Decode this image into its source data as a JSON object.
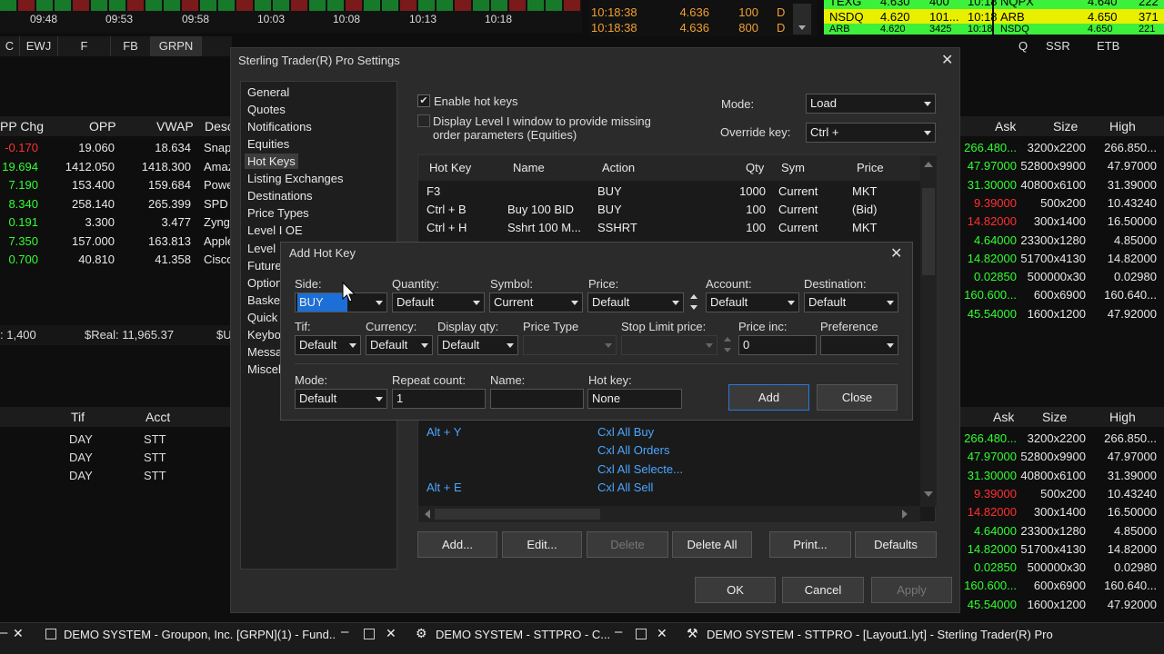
{
  "chart": {
    "times": [
      "09:48",
      "09:53",
      "09:58",
      "10:03",
      "10:08",
      "10:13",
      "10:18"
    ]
  },
  "time_sales": [
    {
      "time": "10:18:38",
      "price": "4.636",
      "size": "100",
      "ex": "D"
    },
    {
      "time": "10:18:38",
      "price": "4.636",
      "size": "800",
      "ex": "D"
    }
  ],
  "level2": {
    "row1": [
      "TEXG",
      "4.630",
      "400",
      "10:18",
      "NQPX",
      "4.640",
      "222"
    ],
    "row2": [
      "NSDQ",
      "4.620",
      "101...",
      "10:18",
      "ARB",
      "4.650",
      "371"
    ],
    "row3": [
      "ARB",
      "4.620",
      "3425",
      "10:18",
      "NSDQ",
      "4.650",
      "221"
    ]
  },
  "tabs": [
    "C",
    "EWJ",
    "F",
    "FB",
    "GRPN"
  ],
  "ticker_headers": {
    "pp_chg": "PP Chg",
    "opp": "OPP",
    "vwap": "VWAP",
    "desc": "Desc"
  },
  "ticker_rows": [
    {
      "chg": "-0.170",
      "opp": "19.060",
      "vwap": "18.634",
      "desc": "Snap",
      "cls": "red"
    },
    {
      "chg": "19.694",
      "opp": "1412.050",
      "vwap": "1418.300",
      "desc": "Amaz",
      "cls": "grn"
    },
    {
      "chg": "7.190",
      "opp": "153.400",
      "vwap": "159.684",
      "desc": "Powe",
      "cls": "grn"
    },
    {
      "chg": "8.340",
      "opp": "258.140",
      "vwap": "265.399",
      "desc": "SPD",
      "cls": "grn"
    },
    {
      "chg": "0.191",
      "opp": "3.300",
      "vwap": "3.477",
      "desc": "Zyng",
      "cls": "grn"
    },
    {
      "chg": "7.350",
      "opp": "157.000",
      "vwap": "163.813",
      "desc": "Apple",
      "cls": "grn"
    },
    {
      "chg": "0.700",
      "opp": "40.810",
      "vwap": "41.358",
      "desc": "Cisco",
      "cls": "grn"
    }
  ],
  "account_bar": {
    "left": ": 1,400",
    "sreal": "$Real: 11,965.37",
    "su": "$U"
  },
  "orders_headers": {
    "tif": "Tif",
    "acct": "Acct"
  },
  "orders_rows": [
    [
      "DAY",
      "STT"
    ],
    [
      "DAY",
      "STT"
    ],
    [
      "DAY",
      "STT"
    ]
  ],
  "right_headers": {
    "q": "Q",
    "ssr": "SSR",
    "etb": "ETB",
    "ask": "Ask",
    "size": "Size",
    "high": "High"
  },
  "right_rows": [
    {
      "ask": "266.480...",
      "size": "3200x2200",
      "high": "266.850...",
      "cls": "grn"
    },
    {
      "ask": "47.97000",
      "size": "52800x9900",
      "high": "47.97000",
      "cls": "grn"
    },
    {
      "ask": "31.30000",
      "size": "40800x6100",
      "high": "31.39000",
      "cls": "grn"
    },
    {
      "ask": "9.39000",
      "size": "500x200",
      "high": "10.43240",
      "cls": "red"
    },
    {
      "ask": "14.82000",
      "size": "300x1400",
      "high": "16.50000",
      "cls": "red"
    },
    {
      "ask": "4.64000",
      "size": "23300x1280",
      "high": "4.85000",
      "cls": "grn"
    },
    {
      "ask": "14.82000",
      "size": "51700x4130",
      "high": "14.82000",
      "cls": "grn"
    },
    {
      "ask": "0.02850",
      "size": "500000x30",
      "high": "0.02980",
      "cls": "grn"
    },
    {
      "ask": "160.600...",
      "size": "600x6900",
      "high": "160.640...",
      "cls": "grn"
    },
    {
      "ask": "45.54000",
      "size": "1600x1200",
      "high": "47.92000",
      "cls": "grn"
    }
  ],
  "settings": {
    "title": "Sterling Trader(R) Pro Settings",
    "nav": [
      "General",
      "Quotes",
      "Notifications",
      "Equities",
      "Hot Keys",
      "Listing Exchanges",
      "Destinations",
      "Price Types",
      "Level I OE",
      "Level",
      "Future",
      "Option",
      "Baske",
      "Quick",
      "Keybo",
      "Messa",
      "Miscel"
    ],
    "enable_hotkeys": "Enable hot keys",
    "display_level1": "Display Level I window to provide missing order parameters (Equities)",
    "mode_label": "Mode:",
    "mode_value": "Load",
    "override_label": "Override key:",
    "override_value": "Ctrl +",
    "table_headers": [
      "Hot Key",
      "Name",
      "Action",
      "Qty",
      "Sym",
      "Price"
    ],
    "rows": [
      [
        "F3",
        "",
        "BUY",
        "1000",
        "Current",
        "MKT"
      ],
      [
        "Ctrl + B",
        "Buy 100 BID",
        "BUY",
        "100",
        "Current",
        "(Bid)"
      ],
      [
        "Ctrl + H",
        "Sshrt 100 M...",
        "SSHRT",
        "100",
        "Current",
        "MKT"
      ]
    ],
    "blue_rows": [
      [
        "Alt + Y",
        "Cxl All Buy"
      ],
      [
        "",
        "Cxl All Orders"
      ],
      [
        "",
        "Cxl All Selecte..."
      ],
      [
        "Alt + E",
        "Cxl All Sell"
      ]
    ],
    "buttons": {
      "add": "Add...",
      "edit": "Edit...",
      "delete": "Delete",
      "delete_all": "Delete All",
      "print": "Print...",
      "defaults": "Defaults"
    },
    "footer": {
      "ok": "OK",
      "cancel": "Cancel",
      "apply": "Apply"
    }
  },
  "add_hotkey": {
    "title": "Add Hot Key",
    "side_label": "Side:",
    "side_value": "BUY",
    "qty_label": "Quantity:",
    "qty_value": "Default",
    "symbol_label": "Symbol:",
    "symbol_value": "Current",
    "price_label": "Price:",
    "price_value": "Default",
    "account_label": "Account:",
    "account_value": "Default",
    "dest_label": "Destination:",
    "dest_value": "Default",
    "tif_label": "Tif:",
    "tif_value": "Default",
    "currency_label": "Currency:",
    "currency_value": "Default",
    "dispqty_label": "Display qty:",
    "dispqty_value": "Default",
    "pricetype_label": "Price Type",
    "stoplimit_label": "Stop Limit price:",
    "priceinc_label": "Price inc:",
    "priceinc_value": "0",
    "pref_label": "Preference",
    "mode_label": "Mode:",
    "mode_value": "Default",
    "repeat_label": "Repeat count:",
    "repeat_value": "1",
    "name_label": "Name:",
    "name_value": "",
    "hotkey_label": "Hot key:",
    "hotkey_value": "None",
    "add": "Add",
    "close": "Close"
  },
  "taskbar": [
    "DEMO SYSTEM - Groupon, Inc. [GRPN](1) - Fund...",
    "DEMO SYSTEM - STTPRO - C...",
    "DEMO SYSTEM - STTPRO - [Layout1.lyt] - Sterling Trader(R) Pro"
  ]
}
